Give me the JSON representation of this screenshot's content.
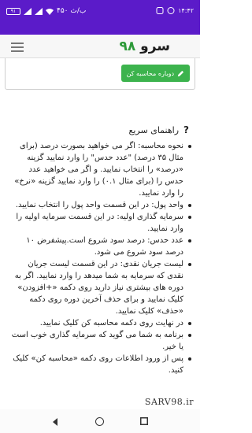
{
  "status_bar": {
    "time": "۱۴:۴۲",
    "battery": "۹۱",
    "speed": "۴۵۰ ب/ث"
  },
  "header": {
    "brand_number": "۹۸",
    "brand_word": "سرو"
  },
  "card": {
    "recalc_label": "دوباره محاسبه کن"
  },
  "guide": {
    "title": "راهنمای سریع",
    "help_symbol": "?",
    "items": [
      "نحوه محاسبه: اگر می خواهید بصورت درصد (برای مثال ۳۵ درصد) \"عدد حدس\" را وارد نمایید گزینه «درصد» را انتخاب نمایید. و اگر می خواهید عدد حدس را (برای مثال ۰.۱) را وارد نمایید گزینه «نرخ» را وارد نمایید.",
      "واحد پول: در این قسمت واحد پول را انتخاب نمایید.",
      "سرمایه گذاری اولیه: در این قسمت سرمایه اولیه را وارد نمایید.",
      "عدد حدس: درصد سود شروع است.پیشفرض ۱۰ درصد سود شروع می شود.",
      "لیست جریان نقدی: در این قسمت لیست جریان نقدی که سرمایه به شما میدهد را وارد نمایید. اگر به دوره های بیشتری نیاز دارید روی دکمه «+افزودن» کلیک نمایید و برای حذف آخرین دوره روی دکمه «حذف» کلیک نمایید.",
      "در نهایت روی دکمه محاسبه کن کلیک نمایید.",
      "برنامه به شما می گوید که سرمایه گذاری خوب است یا خیر.",
      "پس از ورود اطلاعات روی دکمه «محاسبه کن» کلیک کنید."
    ]
  },
  "watermark": "SARV98.ir",
  "colors": {
    "status_bar": "#5b1bc9",
    "brand_green": "#2e9a3a",
    "button_green": "#3cb34d"
  }
}
